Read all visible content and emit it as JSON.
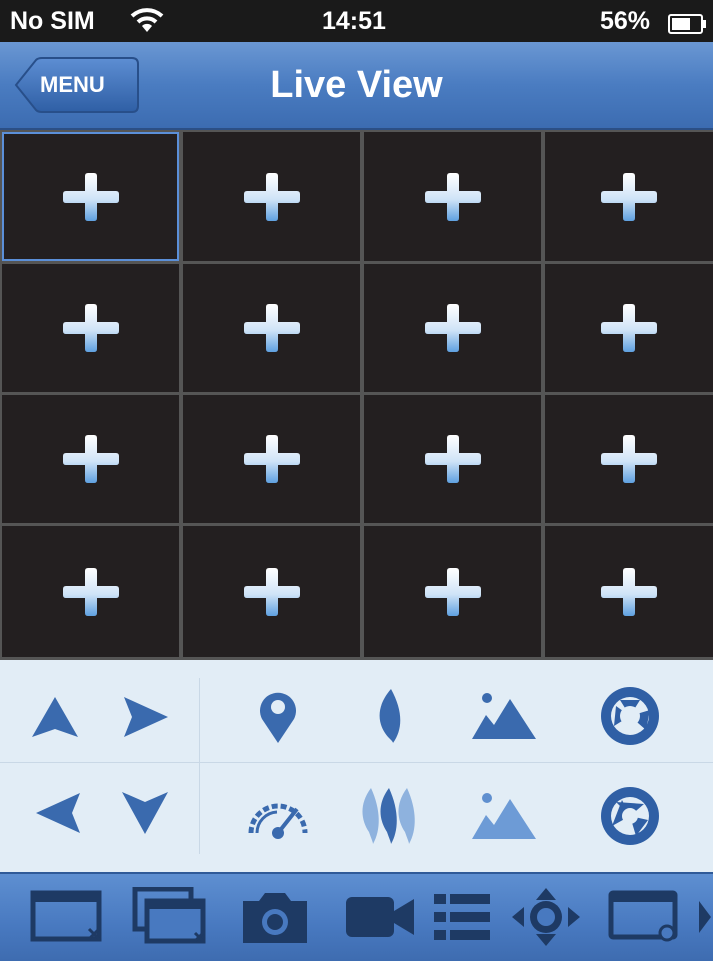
{
  "status_bar": {
    "carrier": "No SIM",
    "time": "14:51",
    "battery": "56%"
  },
  "nav": {
    "back_label": "MENU",
    "title": "Live View"
  },
  "grid": {
    "rows": 4,
    "cols": 4,
    "selected_cell": 1,
    "cell_icon": "plus-icon"
  },
  "ptz": {
    "direction_buttons": [
      "arrow-up-icon",
      "arrow-right-icon",
      "arrow-left-icon",
      "arrow-down-icon"
    ],
    "control_buttons": [
      "focus-pin-icon",
      "zoom-leaf-icon",
      "brightness-image-icon",
      "aperture-icon",
      "speed-gauge-icon",
      "zoom-flames-icon",
      "brightness-image-icon",
      "aperture-icon"
    ]
  },
  "toolbar": {
    "buttons": [
      "close-window-icon",
      "close-all-windows-icon",
      "snapshot-camera-icon",
      "record-video-icon",
      "list-icon",
      "ptz-direction-icon",
      "playback-window-icon",
      "more-arrow-icon"
    ]
  },
  "colors": {
    "accent": "#3a6aae",
    "nav_bar": "#4a7cc1",
    "cell_bg": "#231f20",
    "panel_bg": "#e2edf6"
  }
}
